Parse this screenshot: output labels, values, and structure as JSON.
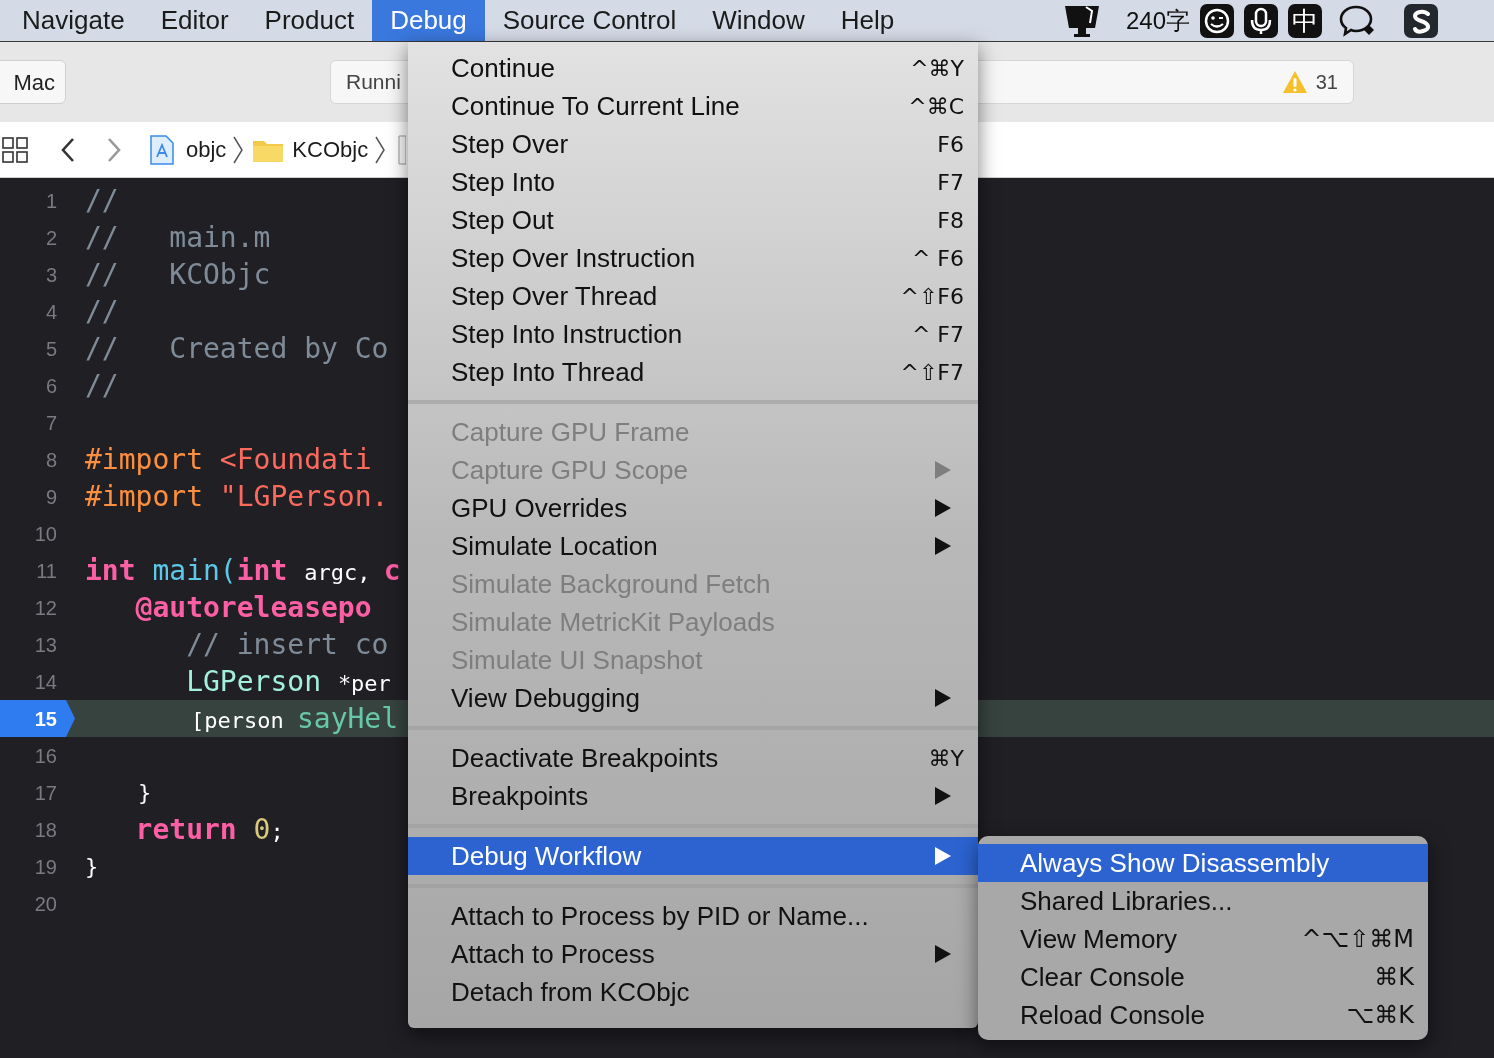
{
  "menu_bar": {
    "items": [
      {
        "label": "Navigate",
        "selected": false
      },
      {
        "label": "Editor",
        "selected": false
      },
      {
        "label": "Product",
        "selected": false
      },
      {
        "label": "Debug",
        "selected": true
      },
      {
        "label": "Source Control",
        "selected": false
      },
      {
        "label": "Window",
        "selected": false
      },
      {
        "label": "Help",
        "selected": false
      }
    ],
    "word_count": "240字",
    "input_method": "中"
  },
  "toolbar": {
    "scheme": "Mac",
    "activity": "Runni",
    "warning_count": "31"
  },
  "jump_bar": {
    "path": [
      {
        "kind": "project",
        "label": "objc"
      },
      {
        "kind": "folder",
        "label": "KCObjc"
      },
      {
        "kind": "file"
      }
    ]
  },
  "editor": {
    "lines": [
      {
        "number": "1",
        "current": false,
        "tokens": [
          {
            "kind": "comment",
            "text": "//"
          }
        ]
      },
      {
        "number": "2",
        "current": false,
        "tokens": [
          {
            "kind": "comment",
            "text": "//   main.m"
          }
        ]
      },
      {
        "number": "3",
        "current": false,
        "tokens": [
          {
            "kind": "comment",
            "text": "//   KCObjc"
          }
        ]
      },
      {
        "number": "4",
        "current": false,
        "tokens": [
          {
            "kind": "comment",
            "text": "//"
          }
        ]
      },
      {
        "number": "5",
        "current": false,
        "tokens": [
          {
            "kind": "comment",
            "text": "//   Created by Co"
          }
        ]
      },
      {
        "number": "6",
        "current": false,
        "tokens": [
          {
            "kind": "comment",
            "text": "//"
          }
        ]
      },
      {
        "number": "7",
        "current": false
      },
      {
        "number": "8",
        "current": false,
        "tokens": [
          {
            "kind": "preprocessor",
            "text": "#import "
          },
          {
            "kind": "string",
            "text": "<Foundati"
          }
        ]
      },
      {
        "number": "9",
        "current": false,
        "tokens": [
          {
            "kind": "preprocessor",
            "text": "#import "
          },
          {
            "kind": "string",
            "text": "\"LGPerson."
          }
        ]
      },
      {
        "number": "10",
        "current": false
      },
      {
        "number": "11",
        "current": false,
        "tokens": [
          {
            "kind": "keyword",
            "text": "int "
          },
          {
            "kind": "function",
            "text": "main("
          },
          {
            "kind": "keyword",
            "text": "int "
          },
          {
            "kind": "plain",
            "text": "argc, "
          },
          {
            "kind": "keyword",
            "text": "c"
          }
        ]
      },
      {
        "number": "12",
        "current": false,
        "tokens": [
          {
            "kind": "keyword",
            "text": "   @autoreleasepo"
          }
        ]
      },
      {
        "number": "13",
        "current": false,
        "tokens": [
          {
            "kind": "comment",
            "text": "      // insert co"
          }
        ]
      },
      {
        "number": "14",
        "current": false,
        "tokens": [
          {
            "kind": "type",
            "text": "      LGPerson "
          },
          {
            "kind": "plain",
            "text": "*per"
          }
        ]
      },
      {
        "number": "15",
        "current": true,
        "tokens": [
          {
            "kind": "plain",
            "text": "        [person "
          },
          {
            "kind": "method",
            "text": "sayHel"
          }
        ]
      },
      {
        "number": "16",
        "current": false
      },
      {
        "number": "17",
        "current": false,
        "tokens": [
          {
            "kind": "plain",
            "text": "    }"
          }
        ]
      },
      {
        "number": "18",
        "current": false,
        "tokens": [
          {
            "kind": "keyword",
            "text": "   return "
          },
          {
            "kind": "number",
            "text": "0"
          },
          {
            "kind": "plain",
            "text": ";"
          }
        ]
      },
      {
        "number": "19",
        "current": false,
        "tokens": [
          {
            "kind": "plain",
            "text": "}"
          }
        ]
      },
      {
        "number": "20",
        "current": false
      }
    ]
  },
  "debug_menu": {
    "sections": [
      {
        "items": [
          {
            "label": "Continue",
            "shortcut": "^⌘Y",
            "disabled": false,
            "submenu": false,
            "selected": false
          },
          {
            "label": "Continue To Current Line",
            "shortcut": "^⌘C",
            "disabled": false,
            "submenu": false,
            "selected": false
          },
          {
            "label": "Step Over",
            "shortcut": "F6",
            "disabled": false,
            "submenu": false,
            "selected": false
          },
          {
            "label": "Step Into",
            "shortcut": "F7",
            "disabled": false,
            "submenu": false,
            "selected": false
          },
          {
            "label": "Step Out",
            "shortcut": "F8",
            "disabled": false,
            "submenu": false,
            "selected": false
          },
          {
            "label": "Step Over Instruction",
            "shortcut": "^ F6",
            "disabled": false,
            "submenu": false,
            "selected": false
          },
          {
            "label": "Step Over Thread",
            "shortcut": "^⇧F6",
            "disabled": false,
            "submenu": false,
            "selected": false
          },
          {
            "label": "Step Into Instruction",
            "shortcut": "^ F7",
            "disabled": false,
            "submenu": false,
            "selected": false
          },
          {
            "label": "Step Into Thread",
            "shortcut": "^⇧F7",
            "disabled": false,
            "submenu": false,
            "selected": false
          }
        ]
      },
      {
        "items": [
          {
            "label": "Capture GPU Frame",
            "disabled": true,
            "submenu": false,
            "selected": false
          },
          {
            "label": "Capture GPU Scope",
            "disabled": true,
            "submenu": true,
            "selected": false
          },
          {
            "label": "GPU Overrides",
            "disabled": false,
            "submenu": true,
            "selected": false
          },
          {
            "label": "Simulate Location",
            "disabled": false,
            "submenu": true,
            "selected": false
          },
          {
            "label": "Simulate Background Fetch",
            "disabled": true,
            "submenu": false,
            "selected": false
          },
          {
            "label": "Simulate MetricKit Payloads",
            "disabled": true,
            "submenu": false,
            "selected": false
          },
          {
            "label": "Simulate UI Snapshot",
            "disabled": true,
            "submenu": false,
            "selected": false
          },
          {
            "label": "View Debugging",
            "disabled": false,
            "submenu": true,
            "selected": false
          }
        ]
      },
      {
        "items": [
          {
            "label": "Deactivate Breakpoints",
            "shortcut": "⌘Y",
            "disabled": false,
            "submenu": false,
            "selected": false
          },
          {
            "label": "Breakpoints",
            "disabled": false,
            "submenu": true,
            "selected": false
          }
        ]
      },
      {
        "items": [
          {
            "label": "Debug Workflow",
            "disabled": false,
            "submenu": true,
            "selected": true
          }
        ]
      },
      {
        "items": [
          {
            "label": "Attach to Process by PID or Name...",
            "disabled": false,
            "submenu": false,
            "selected": false
          },
          {
            "label": "Attach to Process",
            "disabled": false,
            "submenu": true,
            "selected": false
          },
          {
            "label": "Detach from KCObjc",
            "disabled": false,
            "submenu": false,
            "selected": false
          }
        ]
      }
    ]
  },
  "workflow_submenu": {
    "items": [
      {
        "label": "Always Show Disassembly",
        "selected": true
      },
      {
        "label": "Shared Libraries...",
        "selected": false
      },
      {
        "label": "View Memory",
        "shortcut": "^⌥⇧⌘M",
        "selected": false
      },
      {
        "label": "Clear Console",
        "shortcut": "⌘K",
        "selected": false
      },
      {
        "label": "Reload Console",
        "shortcut": "⌥⌘K",
        "selected": false
      }
    ]
  }
}
